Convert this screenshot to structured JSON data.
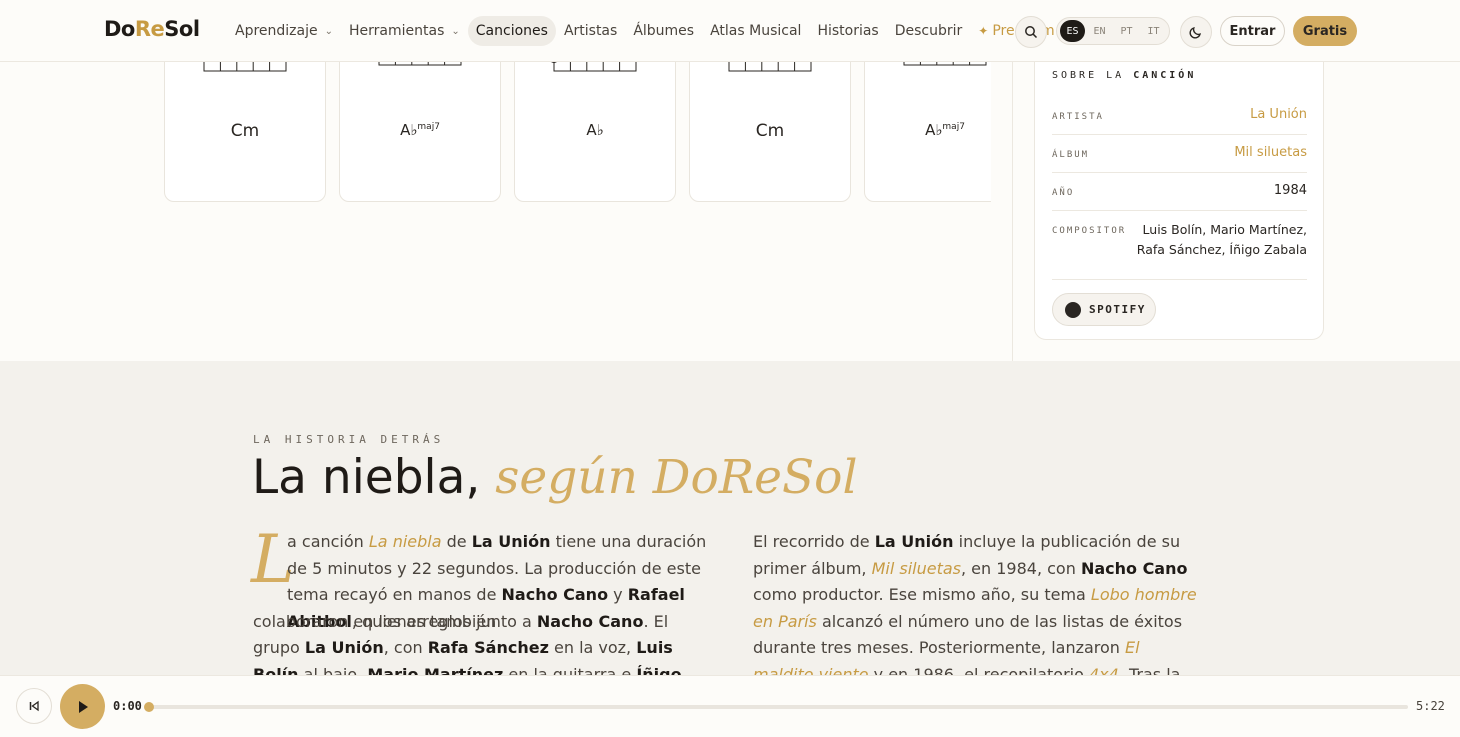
{
  "logo": {
    "part1": "Do",
    "part2": "Re",
    "part3": "Sol"
  },
  "nav": {
    "items": [
      {
        "label": "Aprendizaje",
        "dropdown": true
      },
      {
        "label": "Herramientas",
        "dropdown": true
      },
      {
        "label": "Canciones",
        "active": true
      },
      {
        "label": "Artistas"
      },
      {
        "label": "Álbumes"
      },
      {
        "label": "Atlas Musical"
      },
      {
        "label": "Historias"
      },
      {
        "label": "Descubrir"
      }
    ],
    "premium_label": "Premium",
    "premium_icon": "✦"
  },
  "languages": [
    "ES",
    "EN",
    "PT",
    "IT"
  ],
  "auth": {
    "login_label": "Entrar",
    "signup_label": "Gratis"
  },
  "chords": [
    {
      "root": "Cm",
      "suffix": ""
    },
    {
      "root": "A♭",
      "suffix": "maj7"
    },
    {
      "root": "A♭",
      "suffix": ""
    },
    {
      "root": "Cm",
      "suffix": ""
    },
    {
      "root": "A♭",
      "suffix": "maj7"
    }
  ],
  "song_info": {
    "header_pre": "SOBRE LA",
    "header_bold": "CANCIÓN",
    "rows": [
      {
        "key": "ARTISTA",
        "value": "La Unión"
      },
      {
        "key": "ÁLBUM",
        "value": "Mil siluetas"
      },
      {
        "key": "AÑO",
        "value": "1984"
      },
      {
        "key": "COMPOSITOR",
        "value": "Luis Bolín, Mario Martínez, Rafa Sánchez, Íñigo Zabala"
      }
    ],
    "spotify_label": "SPOTIFY"
  },
  "story": {
    "eyebrow": "LA HISTORIA DETRÁS",
    "title_main": "La niebla,",
    "title_accent": "según DoReSol",
    "dropcap": "L"
  },
  "player": {
    "current_time": "0:00",
    "duration": "5:22",
    "progress": 0
  }
}
